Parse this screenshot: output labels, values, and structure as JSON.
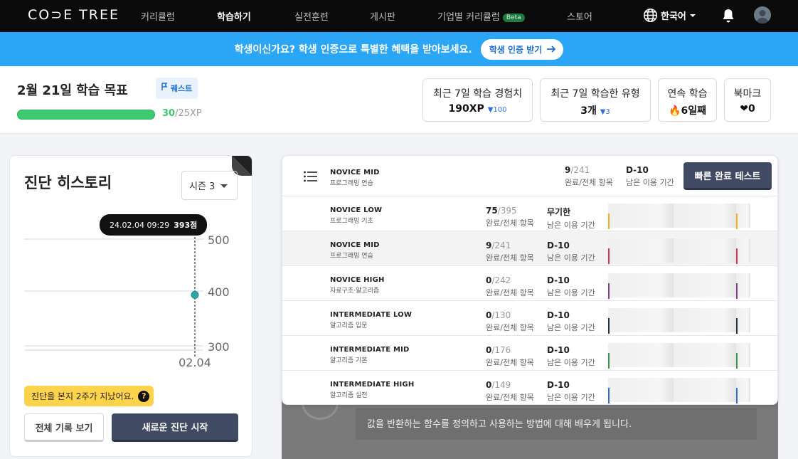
{
  "nav": {
    "logo": "CO⊃E TREE",
    "items": [
      {
        "label": "커리큘럼",
        "active": false
      },
      {
        "label": "학습하기",
        "active": true
      },
      {
        "label": "실전훈련",
        "active": false
      },
      {
        "label": "게시판",
        "active": false
      },
      {
        "label": "기업별 커리큘럼",
        "active": false,
        "badge": "Beta"
      },
      {
        "label": "스토어",
        "active": false
      }
    ],
    "language": "한국어",
    "icons": {
      "globe": "globe-icon",
      "bell": "bell-icon",
      "avatar": "avatar-icon"
    }
  },
  "banner": {
    "text": "학생이신가요? 학생 인증으로 특별한 혜택을 받아보세요.",
    "button": "학생 인증 받기"
  },
  "goal": {
    "title": "2월 21일 학습 목표",
    "quest_label": "퀘스트",
    "xp_current": "30",
    "xp_goal": "/25XP",
    "progress": 1.0,
    "stats": [
      {
        "label": "최근 7일 학습 경험치",
        "value": "190XP",
        "delta": "▼100"
      },
      {
        "label": "최근 7일 학습한 유형",
        "value": "3개",
        "delta": "▼3"
      },
      {
        "label": "연속 학습",
        "value": "🔥6일째",
        "delta": ""
      },
      {
        "label": "북마크",
        "value": "❤0",
        "delta": ""
      }
    ]
  },
  "history": {
    "title": "진단 히스토리",
    "season": "시즌 3",
    "tooltip_date": "24.02.04 09:29",
    "tooltip_score": "393점",
    "chart_data": {
      "type": "scatter",
      "y_ticks": [
        "500",
        "400",
        "300"
      ],
      "x_ticks": [
        "02.04"
      ],
      "ylim": [
        300,
        500
      ],
      "points": [
        {
          "x": "02.04",
          "y": 393
        }
      ]
    },
    "warning": "진단을 본지 2주가 지났어요.",
    "warning_icon": "?",
    "btn_all": "전체 기록 보기",
    "btn_new": "새로운 진단 시작"
  },
  "levels": {
    "current": {
      "name": "NOVICE MID",
      "sub": "프로그래밍 연습",
      "done": "9",
      "total": "/241",
      "count_caption": "완료/전체 항목",
      "period": "D-10",
      "period_caption": "남은 이용 기간"
    },
    "quick_button": "빠른 완료 테스트",
    "rows": [
      {
        "name": "NOVICE LOW",
        "sub": "프로그래밍 기초",
        "done": "75",
        "total": "/395",
        "count_caption": "완료/전체 항목",
        "period": "무기한",
        "period_caption": "남은 이용 기간",
        "color": "#f2b01e",
        "selected": false
      },
      {
        "name": "NOVICE MID",
        "sub": "프로그래밍 연습",
        "done": "9",
        "total": "/241",
        "count_caption": "완료/전체 항목",
        "period": "D-10",
        "period_caption": "남은 이용 기간",
        "color": "#e0334a",
        "selected": true
      },
      {
        "name": "NOVICE HIGH",
        "sub": "자료구조·알고리즘",
        "done": "0",
        "total": "/242",
        "count_caption": "완료/전체 항목",
        "period": "D-10",
        "period_caption": "남은 이용 기간",
        "color": "#8a3a88",
        "selected": false
      },
      {
        "name": "INTERMEDIATE LOW",
        "sub": "알고리즘 입문",
        "done": "0",
        "total": "/130",
        "count_caption": "완료/전체 항목",
        "period": "D-10",
        "period_caption": "남은 이용 기간",
        "color": "#24324a",
        "selected": false
      },
      {
        "name": "INTERMEDIATE MID",
        "sub": "알고리즘 기본",
        "done": "0",
        "total": "/176",
        "count_caption": "완료/전체 항목",
        "period": "D-10",
        "period_caption": "남은 이용 기간",
        "color": "#2f9a4a",
        "selected": false
      },
      {
        "name": "INTERMEDIATE HIGH",
        "sub": "알고리즘 실전",
        "done": "0",
        "total": "/149",
        "count_caption": "완료/전체 항목",
        "period": "D-10",
        "period_caption": "남은 이용 기간",
        "color": "#2b6fd8",
        "selected": false
      }
    ]
  },
  "background": {
    "description": "값을 반환하는 함수를 정의하고 사용하는 방법에 대해 배우게 됩니다."
  }
}
